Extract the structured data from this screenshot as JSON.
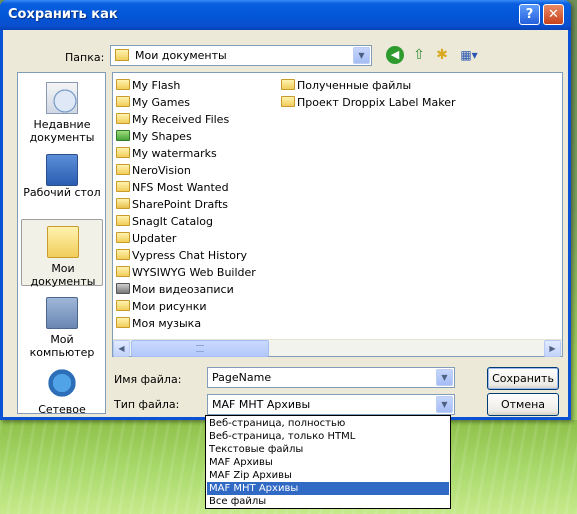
{
  "window": {
    "title": "Сохранить как",
    "help_label": "?",
    "close_label": "✕"
  },
  "folder": {
    "label": "Папка:",
    "value": "Мои документы"
  },
  "places": [
    {
      "label": "Недавние документы",
      "icon": "recent-documents-icon"
    },
    {
      "label": "Рабочий стол",
      "icon": "desktop-icon"
    },
    {
      "label": "Мои документы",
      "icon": "my-documents-icon",
      "selected": true
    },
    {
      "label": "Мой компьютер",
      "icon": "my-computer-icon"
    },
    {
      "label": "Сетевое",
      "icon": "network-icon"
    }
  ],
  "files_col1": [
    "My Flash",
    "My Games",
    "My Received Files",
    "My Shapes",
    "My watermarks",
    "NeroVision",
    "NFS Most Wanted",
    "SharePoint Drafts",
    "SnagIt Catalog",
    "Updater",
    "Vypress Chat History",
    "WYSIWYG Web Builder",
    "Мои видеозаписи",
    "Мои рисунки",
    "Моя музыка"
  ],
  "files_col2": [
    "Полученные файлы",
    "Проект Droppix Label Maker"
  ],
  "filename": {
    "label": "Имя файла:",
    "value": "PageName"
  },
  "filetype": {
    "label": "Тип файла:",
    "value": "MAF MHT Архивы",
    "options": [
      "Веб-страница, полностью",
      "Веб-страница, только HTML",
      "Текстовые файлы",
      "MAF Архивы",
      "MAF Zip Архивы",
      "MAF MHT Архивы",
      "Все файлы"
    ],
    "selected_index": 5
  },
  "buttons": {
    "save": "Сохранить",
    "cancel": "Отмена"
  },
  "colors": {
    "titlebar": "#0256d8",
    "dialog_bg": "#ece9d8",
    "selection": "#316ac5"
  }
}
